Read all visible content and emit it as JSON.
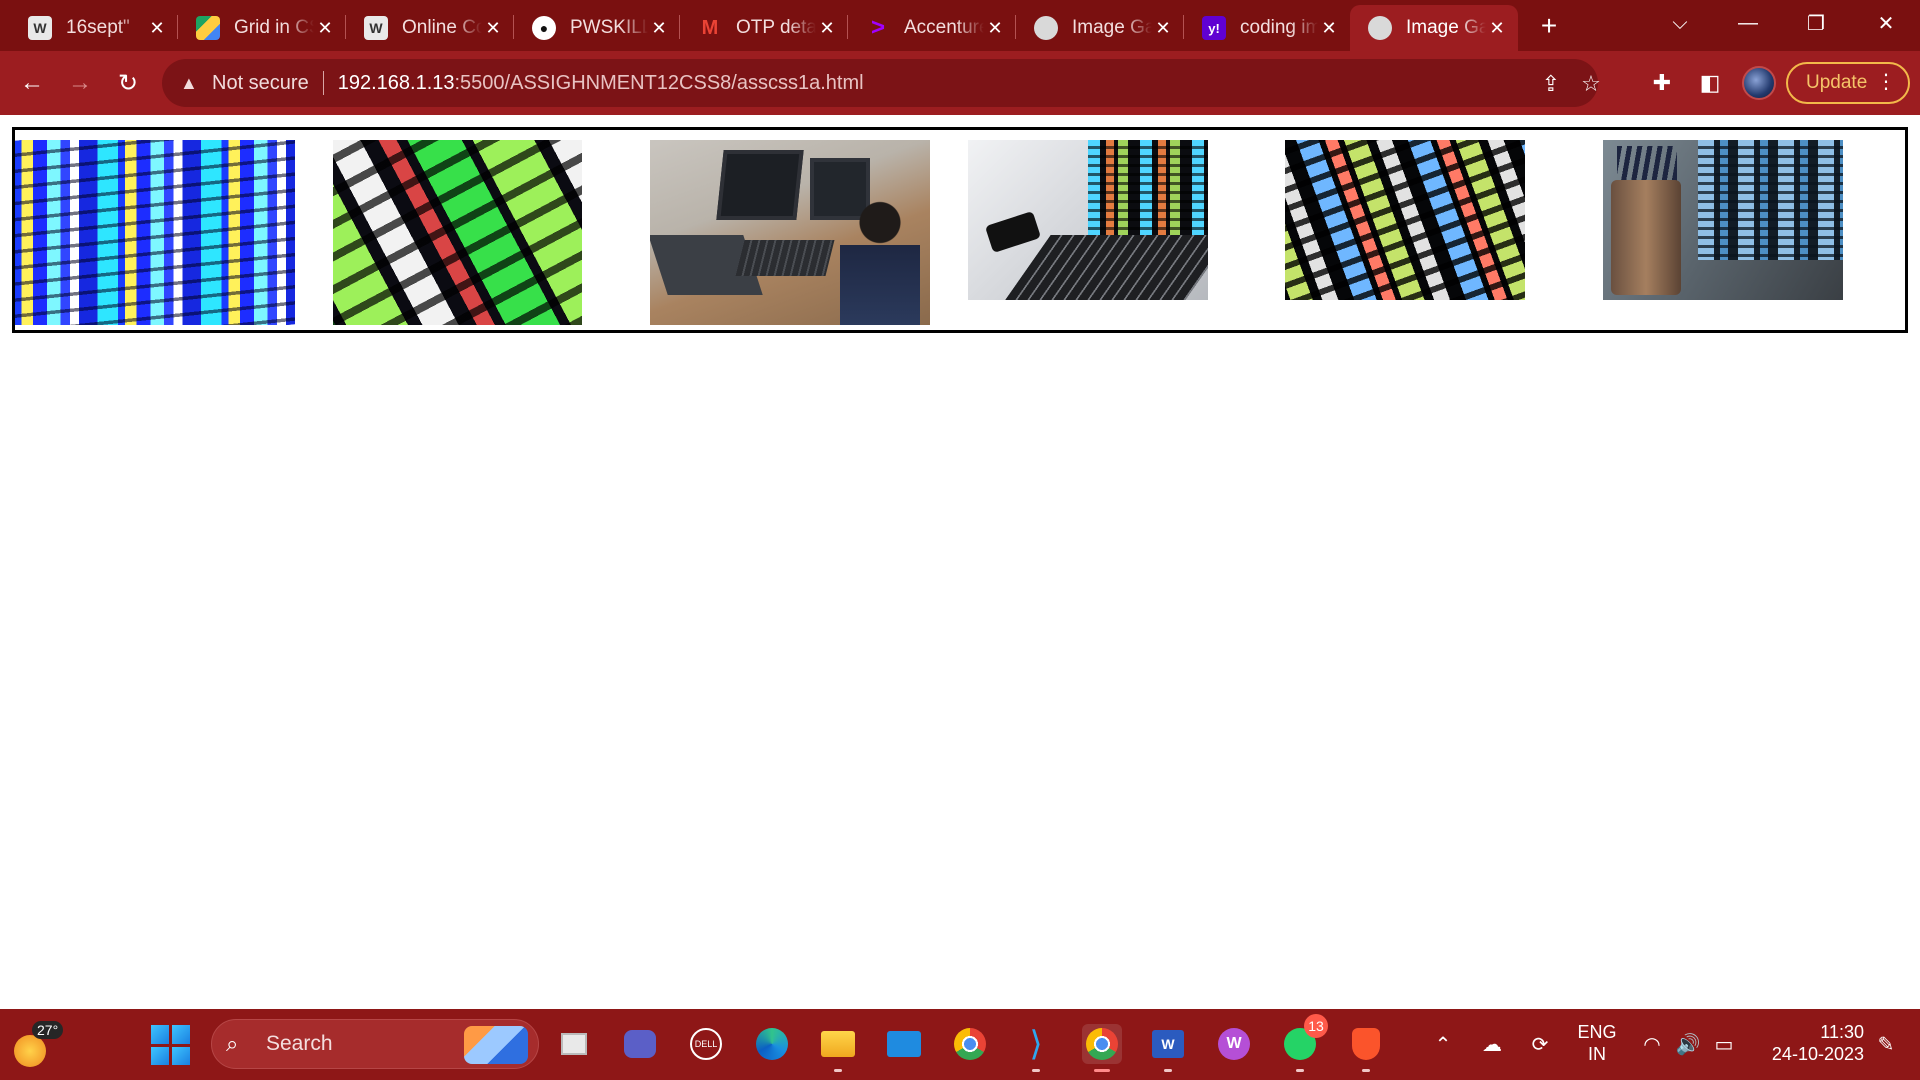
{
  "browser": {
    "tabs": [
      {
        "title": "16sept\"",
        "favicon": "wordpress-icon",
        "color": "#ffffff"
      },
      {
        "title": "Grid in CSS",
        "favicon": "google-drive-icon",
        "color": "#ffffff"
      },
      {
        "title": "Online Compiler",
        "favicon": "wordpress-icon",
        "color": "#ffffff"
      },
      {
        "title": "PWSKILLS",
        "favicon": "github-icon",
        "color": "#ffffff"
      },
      {
        "title": "OTP details",
        "favicon": "gmail-icon",
        "color": "#ffffff"
      },
      {
        "title": "Accenture",
        "favicon": "accenture-icon",
        "color": "#a100ff"
      },
      {
        "title": "Image Gallery",
        "favicon": "globe-icon",
        "color": "#ffffff"
      },
      {
        "title": "coding images",
        "favicon": "yahoo-icon",
        "color": "#6001d2"
      },
      {
        "title": "Image Gallery",
        "favicon": "globe-icon",
        "color": "#ffffff",
        "active": true
      }
    ],
    "address": {
      "security_label": "Not secure",
      "host": "192.168.1.13",
      "path": ":5500/ASSIGHNMENT12CSS8/asscss1a.html"
    },
    "update_label": "Update"
  },
  "page": {
    "images": [
      {
        "name": "code-screen-blue-image"
      },
      {
        "name": "code-screen-green-image"
      },
      {
        "name": "programmer-at-desk-image"
      },
      {
        "name": "laptop-with-code-image"
      },
      {
        "name": "dark-code-screen-image"
      },
      {
        "name": "laptop-and-pen-holder-image"
      }
    ]
  },
  "taskbar": {
    "weather_temp": "27°",
    "search_label": "Search",
    "whatsapp_badge": "13",
    "language": "ENG",
    "region": "IN",
    "time": "11:30",
    "date": "24-10-2023"
  }
}
